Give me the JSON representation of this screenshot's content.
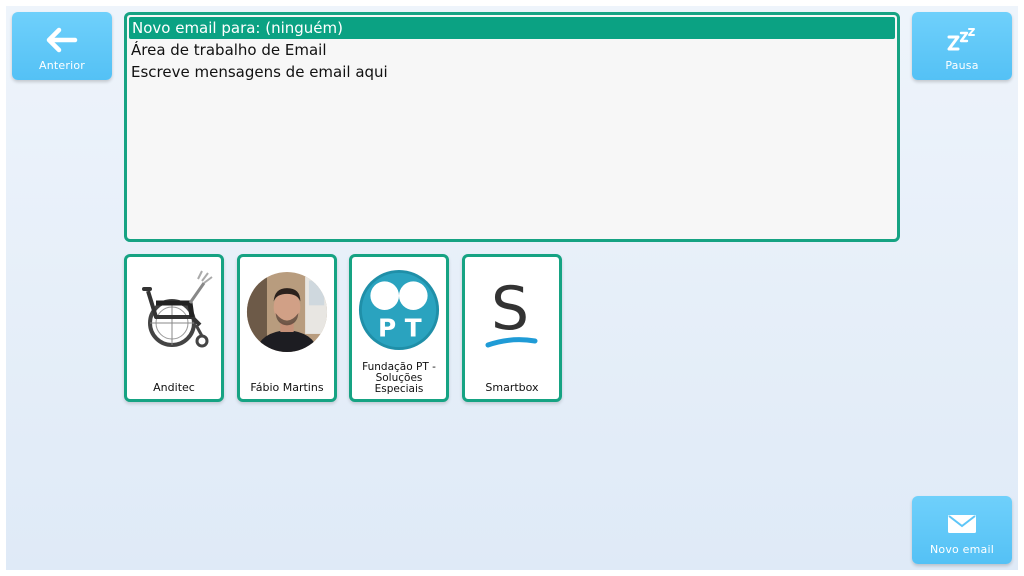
{
  "nav": {
    "back_label": "Anterior",
    "pause_label": "Pausa",
    "new_email_label": "Novo email",
    "icons": {
      "back": "arrow-left-icon",
      "pause": "sleep-zzz-icon",
      "new_email": "envelope-icon"
    }
  },
  "message": {
    "lines": [
      "Novo email para: (ninguém)",
      "Área de trabalho de Email",
      "Escreve mensagens de email aqui"
    ]
  },
  "contacts": [
    {
      "name": "Anditec",
      "image": "wheelchair-image"
    },
    {
      "name": "Fábio Martins",
      "image": "person-photo"
    },
    {
      "name": "Fundação PT - Soluções Especiais",
      "image": "pt-logo",
      "logo_text": "P T"
    },
    {
      "name": "Smartbox",
      "image": "smartbox-logo",
      "logo_text": "S"
    }
  ],
  "colors": {
    "accent_green": "#16a383",
    "highlight_green": "#0ba283",
    "button_blue": "#5ec6f8"
  }
}
